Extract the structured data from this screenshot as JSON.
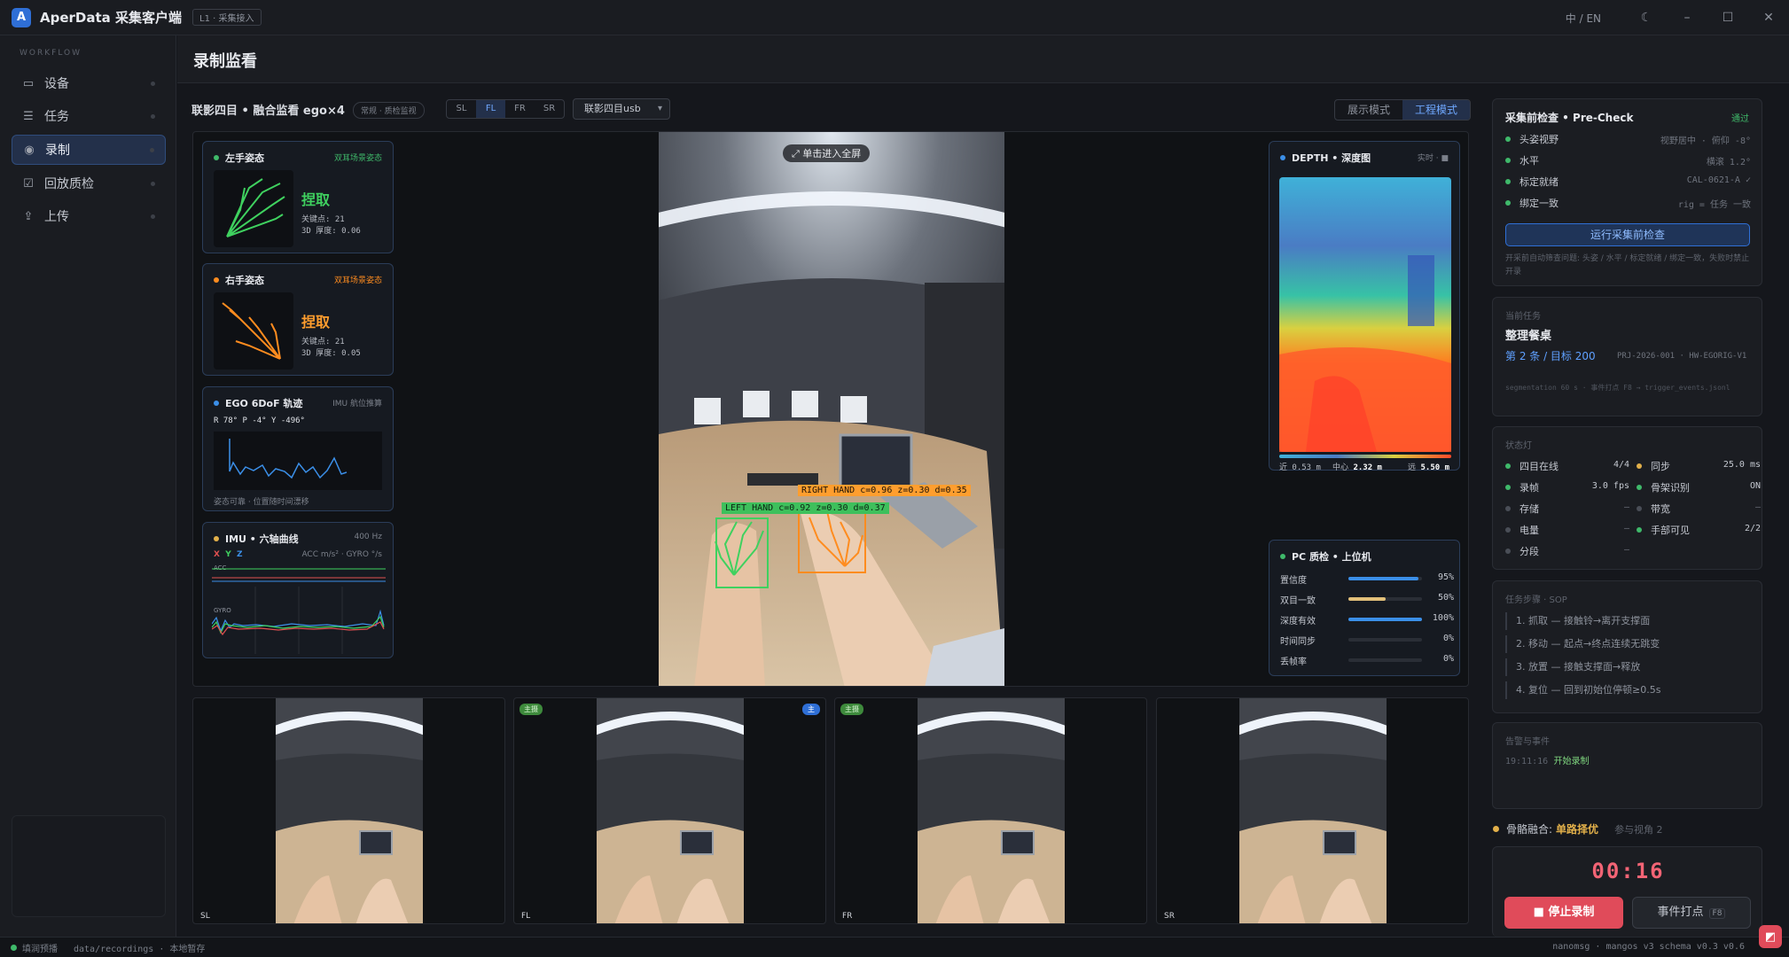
{
  "app": {
    "logo_letter": "A",
    "title": "AperData 采集客户端",
    "badge": "L1 · 采集接入",
    "lang": "中 / EN"
  },
  "sidebar": {
    "section": "WORKFLOW",
    "items": [
      {
        "icon": "monitor-icon",
        "label": "设备"
      },
      {
        "icon": "list-icon",
        "label": "任务"
      },
      {
        "icon": "record-icon",
        "label": "录制"
      },
      {
        "icon": "checkbox-icon",
        "label": "回放质检"
      },
      {
        "icon": "upload-icon",
        "label": "上传"
      }
    ]
  },
  "page": {
    "title": "录制监看"
  },
  "view": {
    "title": "联影四目 • 融合监看 ego×4",
    "tag": "常规 · 质检监视",
    "cams": [
      "SL",
      "FL",
      "FR",
      "SR"
    ],
    "active_cam": "FL",
    "camera_select": "联影四目usb",
    "modes": [
      "展示模式",
      "工程模式"
    ],
    "active_mode": "工程模式",
    "fullscreen": "⤢ 单击进入全屏",
    "det_right": "RIGHT HAND c=0.96 z=0.30 d=0.35",
    "det_left": "LEFT HAND c=0.92 z=0.30 d=0.37"
  },
  "left_hand": {
    "title": "左手姿态",
    "tag": "双耳场景姿态",
    "gesture": "捏取",
    "kp_label": "关键点:",
    "kp": "21",
    "th_label": "3D 厚度:",
    "th": "0.06",
    "color": "#3fd15f"
  },
  "right_hand": {
    "title": "右手姿态",
    "tag": "双耳场景姿态",
    "gesture": "捏取",
    "kp_label": "关键点:",
    "kp": "21",
    "th_label": "3D 厚度:",
    "th": "0.05",
    "color": "#ff8c1f"
  },
  "ego": {
    "title": "EGO 6DoF 轨迹",
    "tag": "IMU 航位推算",
    "readout": "R 78°  P -4°  Y -496°",
    "footer": "姿态可靠 · 位置随时间漂移"
  },
  "imu": {
    "title": "IMU • 六轴曲线",
    "rate": "400 Hz",
    "axes": [
      "X",
      "Y",
      "Z"
    ],
    "units": "ACC m/s² · GYRO °/s",
    "acc": "ACC",
    "gyro": "GYRO"
  },
  "depth": {
    "title": "DEPTH • 深度图",
    "tag": "实时 · ■",
    "near": "近 0.53 m",
    "center_label": "中心",
    "center": "2.32 m",
    "far_label": "远",
    "far": "5.50 m"
  },
  "pc": {
    "title": "PC 质检 • 上位机",
    "rows": [
      {
        "label": "置信度",
        "value": "95%",
        "pct": 95,
        "color": "#3b8fe8"
      },
      {
        "label": "双目一致",
        "value": "50%",
        "pct": 50,
        "color": "#e2c07a"
      },
      {
        "label": "深度有效",
        "value": "100%",
        "pct": 100,
        "color": "#3b8fe8"
      },
      {
        "label": "时间同步",
        "value": "0%",
        "pct": 0,
        "color": "#3b8fe8"
      },
      {
        "label": "丢帧率",
        "value": "0%",
        "pct": 0,
        "color": "#3b8fe8"
      }
    ]
  },
  "thumbs": [
    {
      "label": "SL",
      "tag": "",
      "tag2": ""
    },
    {
      "label": "FL",
      "tag": "主摄",
      "tag2": "主"
    },
    {
      "label": "FR",
      "tag": "主摄",
      "tag2": ""
    },
    {
      "label": "SR",
      "tag": "",
      "tag2": ""
    }
  ],
  "precheck": {
    "title": "采集前检查 • Pre-Check",
    "status": "通过",
    "items": [
      {
        "label": "头姿视野",
        "value": "视野居中 · 俯仰 -8°"
      },
      {
        "label": "水平",
        "value": "横滚 1.2°"
      },
      {
        "label": "标定就绪",
        "value": "CAL-0621-A ✓"
      },
      {
        "label": "绑定一致",
        "value": "rig = 任务 一致"
      }
    ],
    "run_label": "运行采集前检查",
    "hint": "开采前自动筛查问题: 头姿 / 水平 / 标定就绪 / 绑定一致，失败时禁止开录"
  },
  "task": {
    "header": "当前任务",
    "name": "整理餐桌",
    "progress": "第 2 条 / 目标 200",
    "project": "PRJ-2026-001 · HW-EGORIG-V1",
    "meta": "segmentation 60 s · 事件打点 F8 → trigger_events.jsonl"
  },
  "status": {
    "header": "状态灯",
    "items": [
      {
        "label": "四目在线",
        "value": "4/4",
        "color": "#3fb96a",
        "vcolor": "#c4c8d0"
      },
      {
        "label": "同步",
        "value": "25.0 ms",
        "color": "#e2b04a",
        "vcolor": "#c4c8d0"
      },
      {
        "label": "录帧",
        "value": "3.0 fps",
        "color": "#3fb96a",
        "vcolor": "#c4c8d0"
      },
      {
        "label": "骨架识别",
        "value": "ON",
        "color": "#3fb96a",
        "vcolor": "#c4c8d0"
      },
      {
        "label": "存储",
        "value": "–",
        "color": "#4a4e57",
        "vcolor": "#6f747e"
      },
      {
        "label": "带宽",
        "value": "–",
        "color": "#4a4e57",
        "vcolor": "#6f747e"
      },
      {
        "label": "电量",
        "value": "–",
        "color": "#4a4e57",
        "vcolor": "#6f747e"
      },
      {
        "label": "手部可见",
        "value": "2/2",
        "color": "#3fb96a",
        "vcolor": "#c4c8d0"
      },
      {
        "label": "分段",
        "value": "–",
        "color": "#4a4e57",
        "vcolor": "#6f747e"
      }
    ]
  },
  "sop": {
    "header": "任务步骤 · SOP",
    "steps": [
      "1. 抓取 — 接触铃→离开支撑面",
      "2. 移动 — 起点→终点连续无跳变",
      "3. 放置 — 接触支撑面→释放",
      "4. 复位 — 回到初始位停顿≥0.5s"
    ]
  },
  "events": {
    "header": "告警与事件",
    "time": "19:11:16",
    "text": "开始录制"
  },
  "fusion": {
    "label": "骨骼融合:",
    "value": "单路择优",
    "extra": "参与视角 2"
  },
  "rec": {
    "timer": "00:16",
    "stop": "■ 停止录制",
    "event": "事件打点",
    "event_key": "F8"
  },
  "statusbar": {
    "left": "填润预播",
    "path": "data/recordings · 本地暂存",
    "right": "nanomsg · mangos v3    schema v0.3    v0.6"
  }
}
